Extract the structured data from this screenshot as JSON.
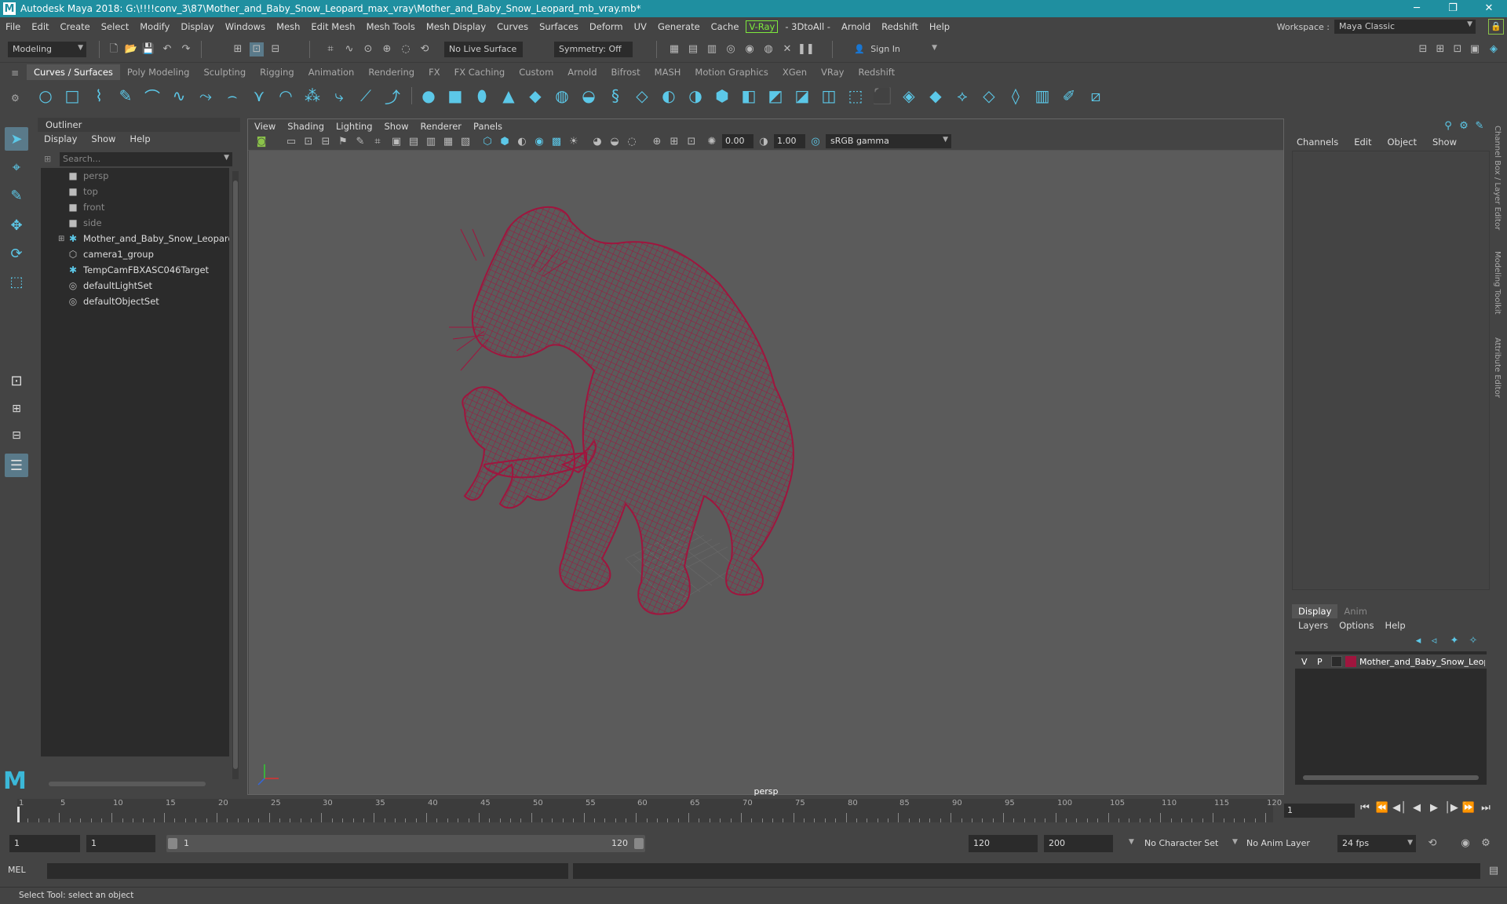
{
  "window": {
    "title": "Autodesk Maya 2018: G:\\!!!!conv_3\\87\\Mother_and_Baby_Snow_Leopard_max_vray\\Mother_and_Baby_Snow_Leopard_mb_vray.mb*",
    "logo": "M",
    "min_glyph": "─",
    "restore_glyph": "❐",
    "close_glyph": "✕"
  },
  "menubar": {
    "items": [
      "File",
      "Edit",
      "Create",
      "Select",
      "Modify",
      "Display",
      "Windows",
      "Mesh",
      "Edit Mesh",
      "Mesh Tools",
      "Mesh Display",
      "Curves",
      "Surfaces",
      "Deform",
      "UV",
      "Generate",
      "Cache"
    ],
    "vray": "V-Ray",
    "items2": [
      "- 3DtoAll -",
      "Arnold",
      "Redshift",
      "Help"
    ],
    "workspace_label": "Workspace :",
    "workspace_value": "Maya Classic"
  },
  "statusline": {
    "mode": "Modeling",
    "live_surface": "No Live Surface",
    "symmetry": "Symmetry: Off",
    "sign_in": "Sign In"
  },
  "shelf": {
    "tabs": [
      "Curves / Surfaces",
      "Poly Modeling",
      "Sculpting",
      "Rigging",
      "Animation",
      "Rendering",
      "FX",
      "FX Caching",
      "Custom",
      "Arnold",
      "Bifrost",
      "MASH",
      "Motion Graphics",
      "XGen",
      "VRay",
      "Redshift"
    ],
    "active_tab": "Curves / Surfaces",
    "icon_color": "#5cc8e8"
  },
  "outliner": {
    "title": "Outliner",
    "menu": [
      "Display",
      "Show",
      "Help"
    ],
    "search_placeholder": "Search...",
    "items": [
      {
        "label": "persp",
        "icon": "camera-icon",
        "dim": true
      },
      {
        "label": "top",
        "icon": "camera-icon",
        "dim": true
      },
      {
        "label": "front",
        "icon": "camera-icon",
        "dim": true
      },
      {
        "label": "side",
        "icon": "camera-icon",
        "dim": true
      },
      {
        "label": "Mother_and_Baby_Snow_Leopard_nc",
        "icon": "transform-icon",
        "dim": false
      },
      {
        "label": "camera1_group",
        "icon": "group-icon",
        "dim": false
      },
      {
        "label": "TempCamFBXASC046Target",
        "icon": "transform-icon",
        "dim": false
      },
      {
        "label": "defaultLightSet",
        "icon": "set-icon",
        "dim": false
      },
      {
        "label": "defaultObjectSet",
        "icon": "set-icon",
        "dim": false
      }
    ]
  },
  "viewport": {
    "menu": [
      "View",
      "Shading",
      "Lighting",
      "Show",
      "Renderer",
      "Panels"
    ],
    "exposure": "0.00",
    "gamma": "1.00",
    "colorspace": "sRGB gamma",
    "camera_label": "persp",
    "wire_color": "#a0153e",
    "background": "#5b5b5b"
  },
  "channelbox": {
    "menu": [
      "Channels",
      "Edit",
      "Object",
      "Show"
    ]
  },
  "layers": {
    "tabs": [
      "Display",
      "Anim"
    ],
    "active_tab": "Display",
    "menu": [
      "Layers",
      "Options",
      "Help"
    ],
    "rows": [
      {
        "v": "V",
        "p": "P",
        "name": "Mother_and_Baby_Snow_Leopard",
        "color": "#a0153e"
      }
    ]
  },
  "sidetabs": [
    "Channel Box / Layer Editor",
    "Modeling Toolkit",
    "Attribute Editor"
  ],
  "timeline": {
    "labels": [
      "1",
      "5",
      "10",
      "15",
      "20",
      "25",
      "30",
      "35",
      "40",
      "45",
      "50",
      "55",
      "60",
      "65",
      "70",
      "75",
      "80",
      "85",
      "90",
      "95",
      "100",
      "105",
      "110",
      "115",
      "120"
    ],
    "current_frame": "1"
  },
  "range": {
    "start": "1",
    "playback_start": "1",
    "range_start_label": "1",
    "range_end_label": "120",
    "playback_end": "120",
    "end": "200",
    "character_set": "No Character Set",
    "anim_layer": "No Anim Layer",
    "fps": "24 fps"
  },
  "cmdline": {
    "label": "MEL"
  },
  "help": {
    "text": "Select Tool: select an object"
  }
}
